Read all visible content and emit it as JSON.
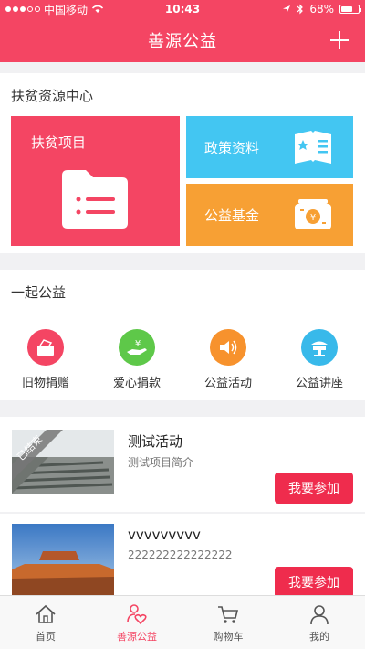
{
  "status_bar": {
    "carrier": "中国移动",
    "time": "10:43",
    "battery": "68%",
    "battery_level": 0.68
  },
  "nav": {
    "title": "善源公益"
  },
  "poverty_center": {
    "title": "扶贫资源中心",
    "tiles": [
      {
        "label": "扶贫项目",
        "color": "#f44563"
      },
      {
        "label": "政策资料",
        "color": "#43c6f2"
      },
      {
        "label": "公益基金",
        "color": "#f7a034"
      }
    ]
  },
  "together": {
    "title": "一起公益",
    "items": [
      {
        "label": "旧物捐赠",
        "color": "#f44563"
      },
      {
        "label": "爱心捐款",
        "color": "#5ec849"
      },
      {
        "label": "公益活动",
        "color": "#f7922d"
      },
      {
        "label": "公益讲座",
        "color": "#38b9ea"
      }
    ]
  },
  "list": [
    {
      "title": "测试活动",
      "desc": "测试项目简介",
      "badge": "已结束",
      "button": "我要参加"
    },
    {
      "title": "vvvvvvvvv",
      "desc": "222222222222222",
      "button": "我要参加"
    }
  ],
  "tabbar": {
    "tabs": [
      {
        "label": "首页"
      },
      {
        "label": "善源公益"
      },
      {
        "label": "购物车"
      },
      {
        "label": "我的"
      }
    ]
  }
}
